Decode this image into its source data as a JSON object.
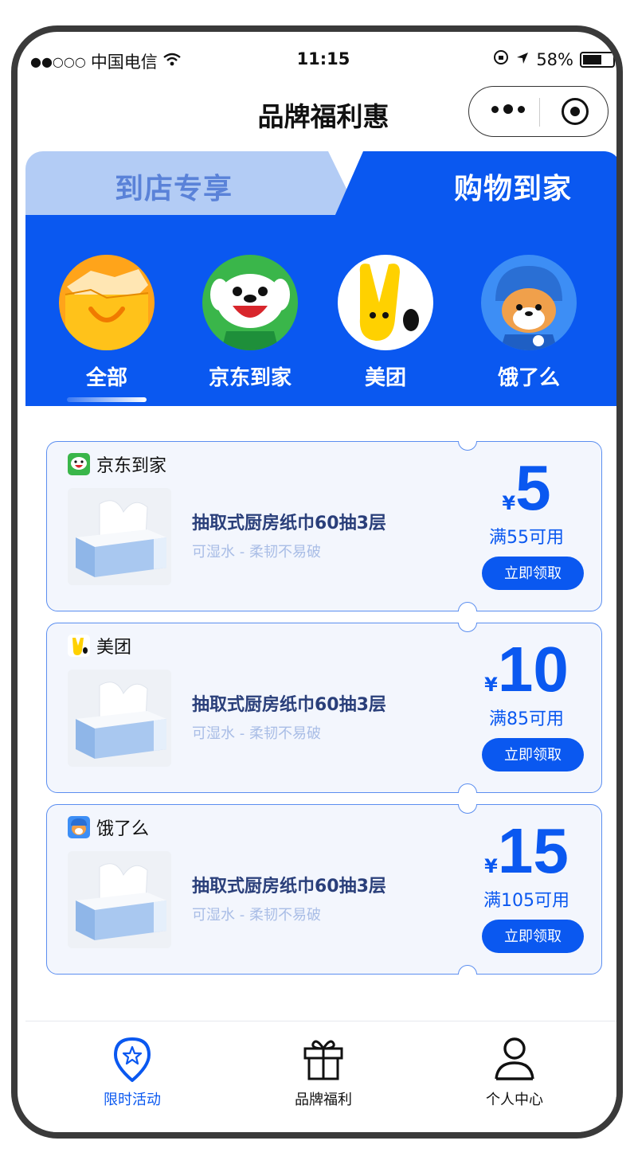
{
  "status_bar": {
    "carrier": "中国电信",
    "signal_dots": "●●○○○",
    "time": "11:15",
    "battery_percent": "58%"
  },
  "navbar": {
    "title": "品牌福利惠",
    "icons": [
      "more-dots-icon",
      "target-icon"
    ]
  },
  "top_tabs": {
    "left": "到店专享",
    "right": "购物到家",
    "active": "right"
  },
  "platforms": [
    {
      "label": "全部",
      "icon": "all-box-icon",
      "active": true
    },
    {
      "label": "京东到家",
      "icon": "jd-dog-icon",
      "active": false
    },
    {
      "label": "美团",
      "icon": "meituan-kangaroo-icon",
      "active": false
    },
    {
      "label": "饿了么",
      "icon": "eleme-shiba-icon",
      "active": false
    }
  ],
  "coupons": [
    {
      "brand": "京东到家",
      "title": "抽取式厨房纸巾60抽3层",
      "subtitle": "可湿水 - 柔韧不易破",
      "currency": "¥",
      "amount": "5",
      "condition": "满55可用",
      "button": "立即领取"
    },
    {
      "brand": "美团",
      "title": "抽取式厨房纸巾60抽3层",
      "subtitle": "可湿水 - 柔韧不易破",
      "currency": "¥",
      "amount": "10",
      "condition": "满85可用",
      "button": "立即领取"
    },
    {
      "brand": "饿了么",
      "title": "抽取式厨房纸巾60抽3层",
      "subtitle": "可湿水 - 柔韧不易破",
      "currency": "¥",
      "amount": "15",
      "condition": "满105可用",
      "button": "立即领取"
    }
  ],
  "tabbar": [
    {
      "label": "限时活动",
      "icon": "location-star-icon",
      "active": true
    },
    {
      "label": "品牌福利",
      "icon": "gift-icon",
      "active": false
    },
    {
      "label": "个人中心",
      "icon": "user-icon",
      "active": false
    }
  ],
  "colors": {
    "accent": "#0a58f0",
    "tab_inactive": "#b3ccf5",
    "card_bg": "#f3f6fd"
  }
}
